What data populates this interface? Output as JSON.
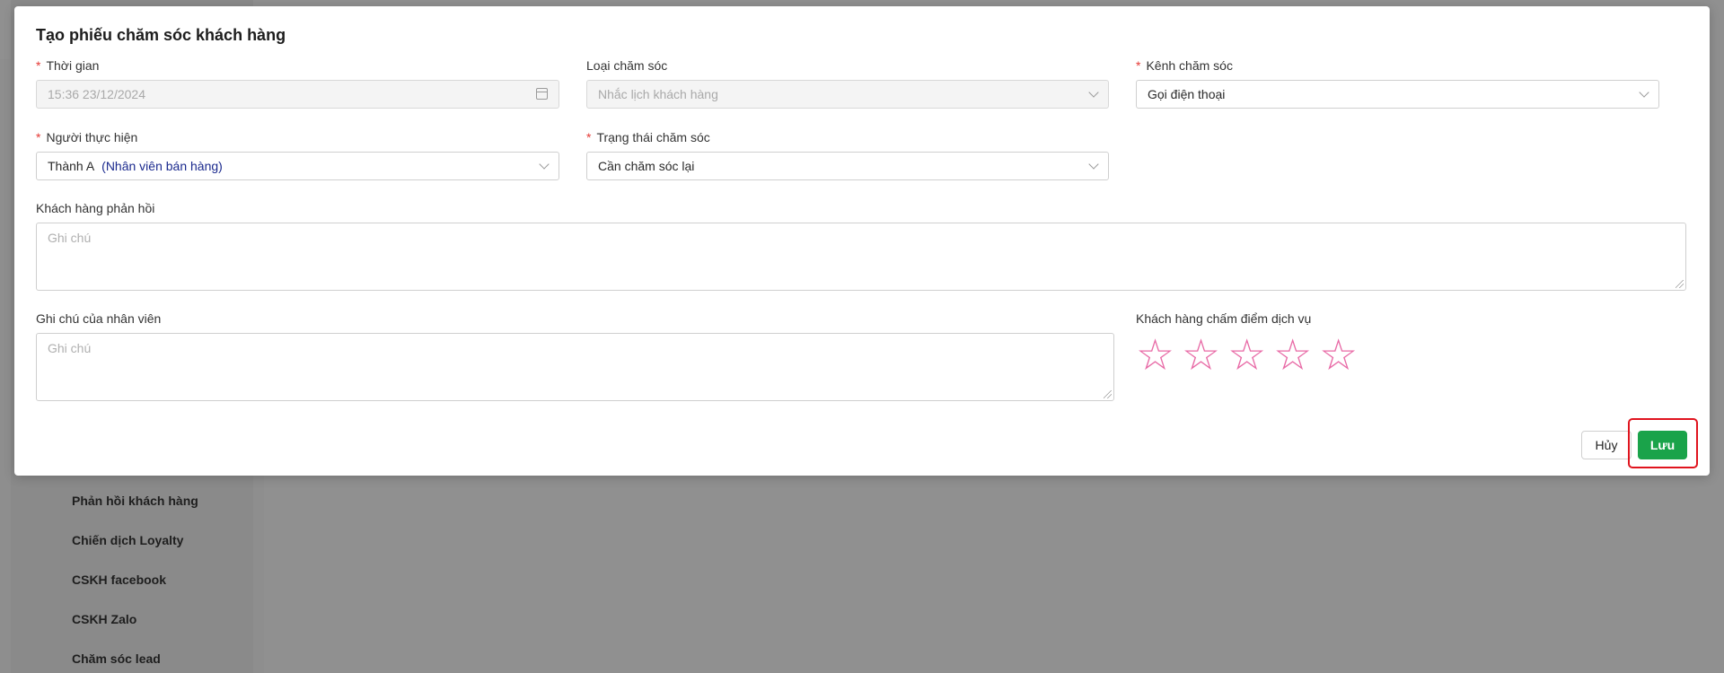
{
  "background": {
    "menu": [
      "Phản hồi khách hàng",
      "Chiến dịch Loyalty",
      "CSKH facebook",
      "CSKH Zalo",
      "Chăm sóc lead"
    ]
  },
  "modal": {
    "title": "Tạo phiếu chăm sóc khách hàng",
    "time": {
      "label": "Thời gian",
      "value": "15:36 23/12/2024"
    },
    "care_type": {
      "label": "Loại chăm sóc",
      "value": "Nhắc lịch khách hàng"
    },
    "care_channel": {
      "label": "Kênh chăm sóc",
      "value": "Gọi điện thoại"
    },
    "performer": {
      "label": "Người thực hiện",
      "value": "Thành A",
      "role": "(Nhân viên bán hàng)"
    },
    "care_status": {
      "label": "Trạng thái chăm sóc",
      "value": "Cần chăm sóc lại"
    },
    "customer_feedback": {
      "label": "Khách hàng phản hồi",
      "placeholder": "Ghi chú"
    },
    "staff_note": {
      "label": "Ghi chú của nhân viên",
      "placeholder": "Ghi chú"
    },
    "rating": {
      "label": "Khách hàng chấm điểm dịch vụ",
      "max": 5,
      "value": 0,
      "star_color": "#e86aa6"
    },
    "buttons": {
      "cancel": "Hủy",
      "save": "Lưu"
    }
  },
  "colors": {
    "primary": "#1aa34a",
    "highlight": "#e0141e",
    "required": "#e53935",
    "role_text": "#1b2a8e"
  }
}
